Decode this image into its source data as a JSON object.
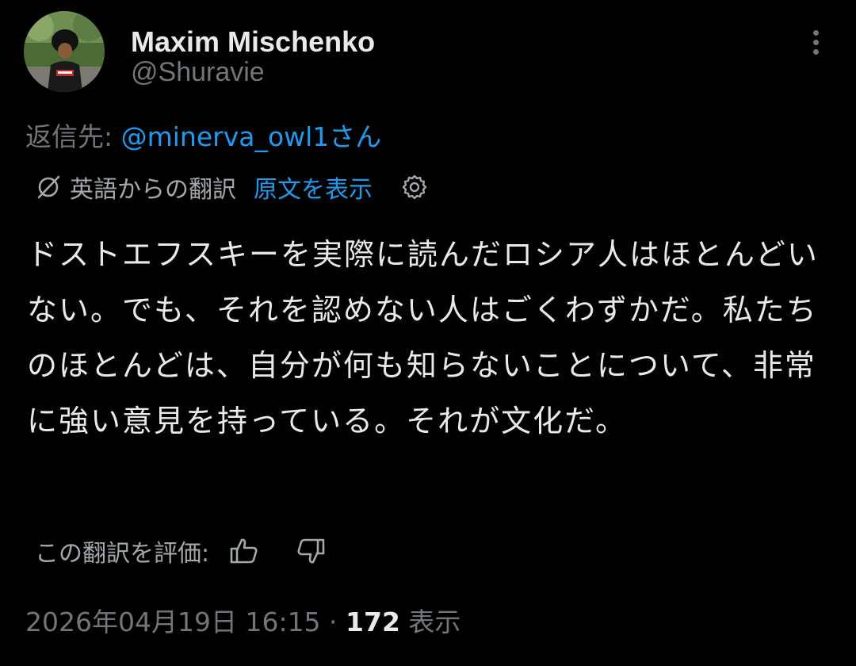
{
  "author": {
    "display_name": "Maxim Mischenko",
    "handle": "@Shuravie",
    "avatar_icon": "profile-photo"
  },
  "reply": {
    "prefix": "返信先: ",
    "mention": "@minerva_owl1さん"
  },
  "translation": {
    "icon": "translate-icon",
    "label": "英語からの翻訳",
    "show_original": "原文を表示",
    "settings_icon": "gear-icon"
  },
  "tweet": {
    "text": "ドストエフスキーを実際に読んだロシア人はほとんどいない。でも、それを認めない人はごくわずかだ。私たちのほとんどは、自分が何も知らないことについて、非常に強い意見を持っている。それが文化だ。"
  },
  "rating": {
    "label": "この翻訳を評価:",
    "up_icon": "thumbs-up-icon",
    "down_icon": "thumbs-down-icon"
  },
  "meta": {
    "timestamp": "2026年04月19日 16:15",
    "separator": " · ",
    "view_count": "172",
    "view_label": " 表示"
  },
  "colors": {
    "background": "#000000",
    "text": "#e7e9ea",
    "secondary": "#71767b",
    "link": "#1d9bf0"
  }
}
